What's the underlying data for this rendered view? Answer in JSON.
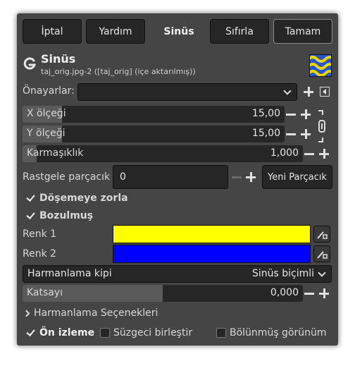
{
  "toolbar": {
    "cancel": "İptal",
    "help": "Yardım",
    "title": "Sinüs",
    "reset": "Sıfırla",
    "ok": "Tamam"
  },
  "header": {
    "title": "Sinüs",
    "subtitle": "taj_orig.jpg-2 ([taj_orig] (içe aktarılmış))",
    "logo_icon": "gimp-g-icon",
    "thumb_icon": "sinus-preview-thumbnail"
  },
  "presets": {
    "label": "Önayarlar:",
    "value": ""
  },
  "x_scale": {
    "label": "X ölçeği",
    "value": "15,00",
    "fill": 0.15
  },
  "y_scale": {
    "label": "Y ölçeği",
    "value": "15,00",
    "fill": 0.15
  },
  "complexity": {
    "label": "Karmaşıklık",
    "value": "1,000",
    "fill": 0.05
  },
  "random_seed": {
    "label": "Rastgele parçacık",
    "value": "0",
    "new_seed": "Yeni Parçacık"
  },
  "force_tiling": {
    "label": "Döşemeye zorla",
    "checked": true
  },
  "distorted": {
    "label": "Bozulmuş",
    "checked": true
  },
  "color1": {
    "label": "Renk 1",
    "color": "#ffff00"
  },
  "color2": {
    "label": "Renk 2",
    "color": "#0000ff"
  },
  "blend_mode": {
    "label": "Harmanlama kipi",
    "value": "Sinüs biçimli"
  },
  "exponent": {
    "label": "Katsayı",
    "value": "0,000",
    "fill": 0.5
  },
  "blend_options": {
    "label": "Harmanlama Seçenekleri"
  },
  "preview": {
    "label": "Ön izleme",
    "checked": true
  },
  "merge_filter": {
    "label": "Süzgeci birleştir",
    "checked": false
  },
  "split_view": {
    "label": "Bölünmüş görünüm",
    "checked": false
  },
  "colors": {
    "bg": "#454545",
    "field": "#262626",
    "fill": "#5a5a5a"
  }
}
